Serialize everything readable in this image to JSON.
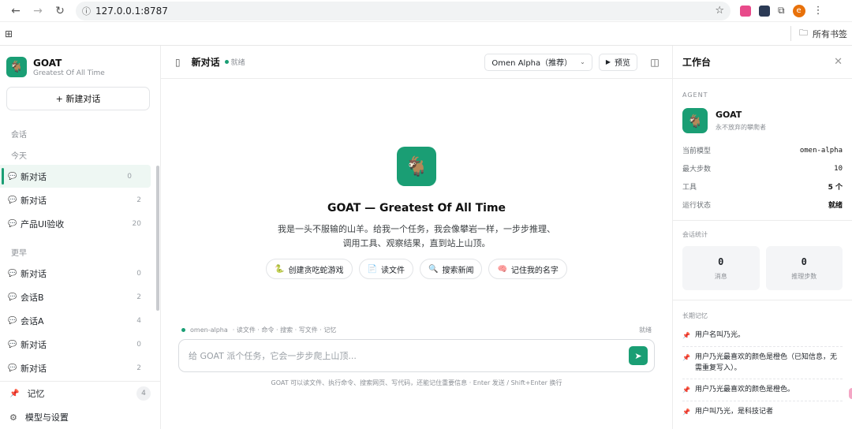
{
  "browser": {
    "url": "127.0.0.1:8787",
    "profile_initial": "e",
    "bookmarks_folder": "所有书签"
  },
  "brand": {
    "name": "GOAT",
    "subtitle": "Greatest Of All Time",
    "logo_emoji": "🐐"
  },
  "sidebar": {
    "new_chat": "+ 新建对话",
    "section_label": "会话",
    "groups": [
      {
        "label": "今天",
        "items": [
          {
            "title": "新对话",
            "count": "0",
            "active": true
          },
          {
            "title": "新对话",
            "count": "2"
          },
          {
            "title": "产品UI验收",
            "count": "20"
          }
        ]
      },
      {
        "label": "更早",
        "items": [
          {
            "title": "新对话",
            "count": "0"
          },
          {
            "title": "会话B",
            "count": "2"
          },
          {
            "title": "会话A",
            "count": "4"
          },
          {
            "title": "新对话",
            "count": "0"
          },
          {
            "title": "新对话",
            "count": "2"
          }
        ]
      }
    ],
    "memory_label": "记忆",
    "memory_count": "4",
    "settings_label": "模型与设置"
  },
  "topbar": {
    "chat_title": "新对话",
    "status": "就绪",
    "model_select": "Omen Alpha（推荐）",
    "preview_label": "预览"
  },
  "hero": {
    "title": "GOAT — Greatest Of All Time",
    "description_line1": "我是一头不服输的山羊。给我一个任务，我会像攀岩一样，一步步推理、",
    "description_line2": "调用工具、观察结果，直到站上山顶。",
    "chips": [
      {
        "icon": "🐍",
        "label": "创建贪吃蛇游戏"
      },
      {
        "icon": "📄",
        "label": "读文件"
      },
      {
        "icon": "🔍",
        "label": "搜索新闻"
      },
      {
        "icon": "🧠",
        "label": "记住我的名字"
      }
    ]
  },
  "composer": {
    "model": "omen-alpha",
    "tools": "· 读文件 · 命令 · 搜索 · 写文件 · 记忆",
    "status": "就绪",
    "placeholder": "给 GOAT 派个任务，它会一步步爬上山顶...",
    "hint": "GOAT 可以读文件、执行命令、搜索网页、写代码，还能记住重要信息 · Enter 发送 / Shift+Enter 换行"
  },
  "panel": {
    "title": "工作台",
    "agent_label": "AGENT",
    "agent_name": "GOAT",
    "agent_tagline": "永不放弃的攀爬者",
    "props": [
      {
        "k": "当前模型",
        "v": "omen-alpha"
      },
      {
        "k": "最大步数",
        "v": "10"
      },
      {
        "k": "工具",
        "v": "5 个"
      },
      {
        "k": "运行状态",
        "v": "就绪"
      }
    ],
    "stats_label": "会话统计",
    "stats": [
      {
        "num": "0",
        "label": "消息"
      },
      {
        "num": "0",
        "label": "推理步数"
      }
    ],
    "memory_label": "长期记忆",
    "memories": [
      "用户名叫乃光。",
      "用户乃光最喜欢的颜色是橙色（已知信息，无需重复写入）。",
      "用户乃光最喜欢的颜色是橙色。",
      "用户叫乃光，是科技记者"
    ]
  }
}
